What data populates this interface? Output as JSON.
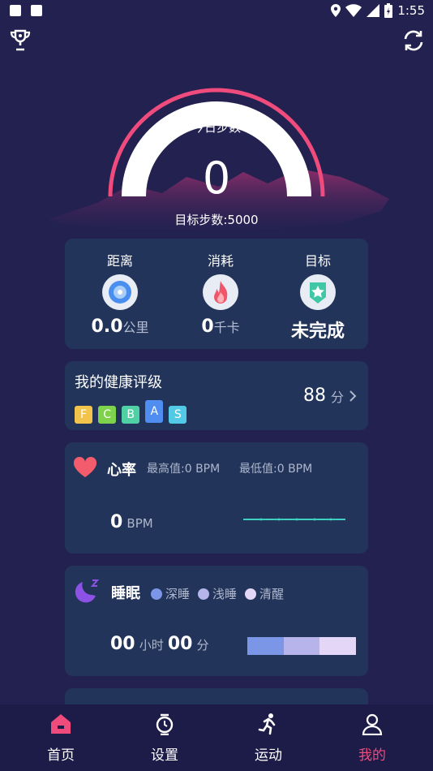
{
  "status_bar": {
    "time": "1:55"
  },
  "header": {
    "trophy_icon": "trophy-icon",
    "sync_icon": "sync-icon"
  },
  "gauge": {
    "title": "今日步数",
    "steps": "0",
    "target": "目标步数:5000"
  },
  "stats": [
    {
      "title": "距离",
      "value": "0.0",
      "unit": "公里",
      "icon": "distance-icon"
    },
    {
      "title": "消耗",
      "value": "0",
      "unit": "千卡",
      "icon": "flame-icon"
    },
    {
      "title": "目标",
      "value": "未完成",
      "unit": "",
      "icon": "star-badge-icon"
    }
  ],
  "health": {
    "title": "我的健康评级",
    "score": "88",
    "score_unit": "分",
    "grades": [
      "F",
      "C",
      "B",
      "A",
      "S"
    ],
    "grade_colors": [
      "#f3c44b",
      "#7fd34c",
      "#4fd1a5",
      "#4f8df0",
      "#52c9e6"
    ]
  },
  "heart": {
    "title": "心率",
    "max_label": "最高值:0 BPM",
    "min_label": "最低值:0 BPM",
    "value": "0",
    "unit": "BPM"
  },
  "sleep": {
    "title": "睡眠",
    "legend": [
      {
        "label": "深睡",
        "color": "#7b96e6"
      },
      {
        "label": "浅睡",
        "color": "#b6b4ea"
      },
      {
        "label": "清醒",
        "color": "#e3d6f6"
      }
    ],
    "hours": "00",
    "hours_unit": "小时",
    "minutes": "00",
    "minutes_unit": "分"
  },
  "tabs": [
    {
      "label": "首页",
      "icon": "home-icon",
      "active": false
    },
    {
      "label": "设置",
      "icon": "watch-icon",
      "active": false
    },
    {
      "label": "运动",
      "icon": "runner-icon",
      "active": false
    },
    {
      "label": "我的",
      "icon": "person-icon",
      "active": true
    }
  ],
  "colors": {
    "accent": "#ef4b7c",
    "background": "#23214f",
    "card": "#223459",
    "teal": "#3ccfc0"
  }
}
